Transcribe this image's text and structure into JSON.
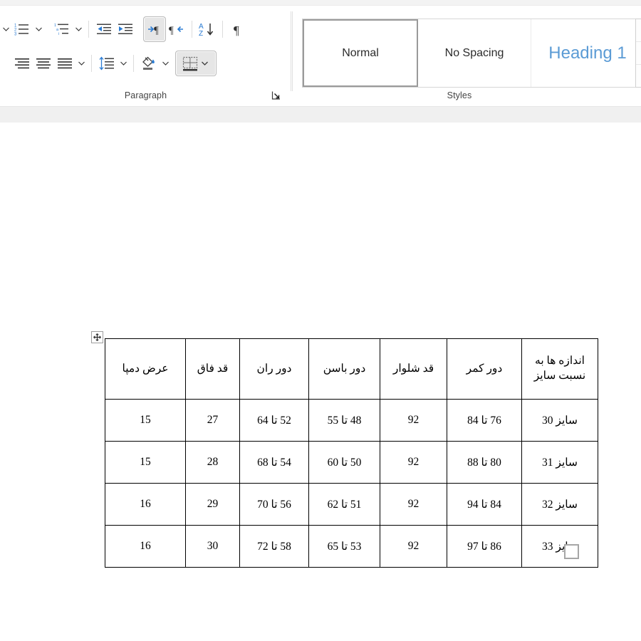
{
  "app": {
    "ribbon": {
      "groups": [
        {
          "name": "paragraph",
          "label": "Paragraph"
        },
        {
          "name": "styles",
          "label": "Styles"
        }
      ],
      "paragraph_tools": {
        "row1": [
          {
            "name": "bullets-caret",
            "icon": "chevron-down-icon",
            "tooltip": "Bullets",
            "state": "normal"
          },
          {
            "name": "numbering",
            "icon": "numbered-list-icon",
            "tooltip": "Numbering",
            "state": "normal"
          },
          {
            "name": "numbering-caret",
            "icon": "chevron-down-icon",
            "tooltip": "Numbering options",
            "state": "normal"
          },
          {
            "name": "multilevel-list",
            "icon": "multilevel-list-icon",
            "tooltip": "Multilevel List",
            "state": "normal"
          },
          {
            "name": "multilevel-list-caret",
            "icon": "chevron-down-icon",
            "tooltip": "Multilevel List options",
            "state": "normal"
          },
          {
            "name": "decrease-indent",
            "icon": "decrease-indent-icon",
            "tooltip": "Decrease Indent",
            "state": "normal"
          },
          {
            "name": "increase-indent",
            "icon": "increase-indent-icon",
            "tooltip": "Increase Indent",
            "state": "normal"
          },
          {
            "name": "right-to-left-text-direction",
            "icon": "rtl-paragraph-icon",
            "tooltip": "Right-to-Left Text Direction",
            "state": "active"
          },
          {
            "name": "left-to-right-text-direction",
            "icon": "ltr-paragraph-icon",
            "tooltip": "Left-to-Right Text Direction",
            "state": "normal"
          },
          {
            "name": "sort",
            "icon": "sort-az-icon",
            "tooltip": "Sort",
            "state": "normal"
          },
          {
            "name": "show-formatting-marks",
            "icon": "pilcrow-icon",
            "tooltip": "Show/Hide Formatting Marks",
            "state": "normal"
          }
        ],
        "row2": [
          {
            "name": "align-right",
            "icon": "align-right-icon",
            "tooltip": "Align Right",
            "state": "normal"
          },
          {
            "name": "align-center",
            "icon": "align-center-icon",
            "tooltip": "Center",
            "state": "normal"
          },
          {
            "name": "justify",
            "icon": "justify-icon",
            "tooltip": "Justify",
            "state": "normal"
          },
          {
            "name": "justify-caret",
            "icon": "chevron-down-icon",
            "tooltip": "Justify options",
            "state": "normal"
          },
          {
            "name": "line-spacing",
            "icon": "line-spacing-icon",
            "tooltip": "Line and Paragraph Spacing",
            "state": "normal"
          },
          {
            "name": "line-spacing-caret",
            "icon": "chevron-down-icon",
            "tooltip": "Line spacing options",
            "state": "normal"
          },
          {
            "name": "shading",
            "icon": "paint-bucket-icon",
            "tooltip": "Shading",
            "state": "normal"
          },
          {
            "name": "shading-caret",
            "icon": "chevron-down-icon",
            "tooltip": "Shading color",
            "state": "normal"
          },
          {
            "name": "borders",
            "icon": "borders-icon",
            "tooltip": "Borders",
            "state": "active"
          },
          {
            "name": "borders-caret",
            "icon": "chevron-down-icon",
            "tooltip": "Borders options",
            "state": "active"
          }
        ]
      },
      "styles_gallery": {
        "items": [
          {
            "label": "Normal",
            "selected": true
          },
          {
            "label": "No Spacing",
            "selected": false
          },
          {
            "label": "Heading 1",
            "selected": false
          }
        ],
        "scroll": {
          "up": "▲",
          "down": "▼",
          "more": "▾"
        }
      },
      "dialog_launcher": {
        "name": "paragraph-dialog-launcher",
        "glyph": "⭨"
      }
    }
  },
  "document": {
    "table": {
      "direction": "rtl",
      "move_handle": "table-move-handle",
      "resize_handle": "table-resize-handle",
      "headers": [
        "اندازه ها به نسبت سایز",
        "دور کمر",
        "قد شلوار",
        "دور باسن",
        "دور ران",
        "قد فاق",
        "عرض دمپا"
      ],
      "rows": [
        {
          "size": "سایز 30",
          "waist": "76 تا 84",
          "pant_length": "92",
          "hip": "48 تا 55",
          "thigh": "52 تا 64",
          "rise": "27",
          "hem_width": "15"
        },
        {
          "size": "سایز 31",
          "waist": "80 تا 88",
          "pant_length": "92",
          "hip": "50 تا 60",
          "thigh": "54 تا 68",
          "rise": "28",
          "hem_width": "15"
        },
        {
          "size": "سایز 32",
          "waist": "84 تا 94",
          "pant_length": "92",
          "hip": "51 تا 62",
          "thigh": "56 تا 70",
          "rise": "29",
          "hem_width": "16"
        },
        {
          "size": "سایز 33",
          "waist": "86 تا 97",
          "pant_length": "92",
          "hip": "53 تا 65",
          "thigh": "58 تا 72",
          "rise": "30",
          "hem_width": "16"
        }
      ]
    }
  },
  "colors": {
    "accent_blue": "#2b7cd3",
    "heading1_blue": "#5b9bd5",
    "ribbon_band": "#f0f0f0",
    "table_border": "#000000",
    "active_button_bg": "#e6e6e6"
  }
}
